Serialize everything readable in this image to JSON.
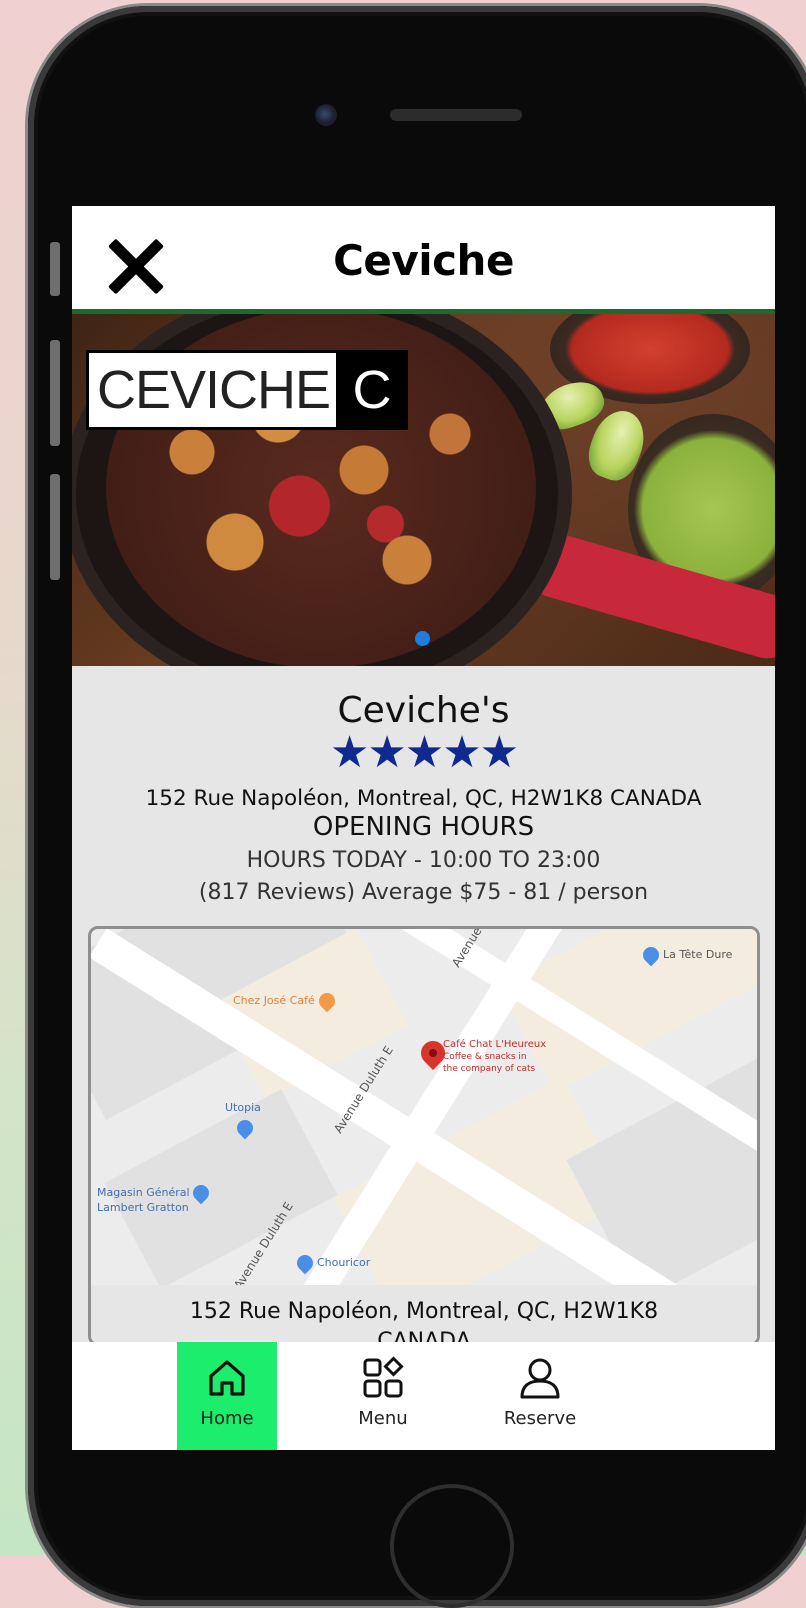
{
  "header": {
    "title": "Ceviche",
    "close_icon": "close-icon"
  },
  "hero": {
    "logo_text": "CEVICHE",
    "logo_mark": "C",
    "carousel_position": 1
  },
  "restaurant": {
    "name": "Ceviche's",
    "rating": 5,
    "rating_max": 5,
    "stars": "★★★★★",
    "address": "152 Rue Napoléon, Montreal, QC, H2W1K8 CANADA",
    "hours_heading": "OPENING HOURS",
    "hours_today": "HOURS TODAY - 10:00 TO 23:00",
    "reviews_line": "(817 Reviews) Average $75 - 81 / person"
  },
  "map": {
    "pois": {
      "la_tete_dure": "La Tête Dure",
      "chez_jose": "Chez José Café",
      "cafe_chat": "Café Chat L'Heureux",
      "cafe_chat_sub1": "Coffee & snacks in",
      "cafe_chat_sub2": "the company of cats",
      "utopia": "Utopia",
      "magasin_1": "Magasin Général",
      "magasin_2": "Lambert Gratton",
      "chouricor": "Chouricor"
    },
    "streets": {
      "duluth_1": "Avenue Duluth E",
      "duluth_2": "Avenue Duluth E",
      "avenue": "Avenue"
    },
    "caption_line1": "152 Rue Napoléon, Montreal, QC, H2W1K8",
    "caption_line2": "CANADA"
  },
  "tabbar": {
    "items": [
      {
        "label": "Home",
        "icon": "home-icon",
        "active": true
      },
      {
        "label": "Menu",
        "icon": "menu-grid-icon",
        "active": false
      },
      {
        "label": "Reserve",
        "icon": "user-icon",
        "active": false
      }
    ]
  },
  "colors": {
    "accent_green": "#1ced6c",
    "header_rule": "#1e6a2e",
    "star_blue": "#0f2a8e"
  }
}
